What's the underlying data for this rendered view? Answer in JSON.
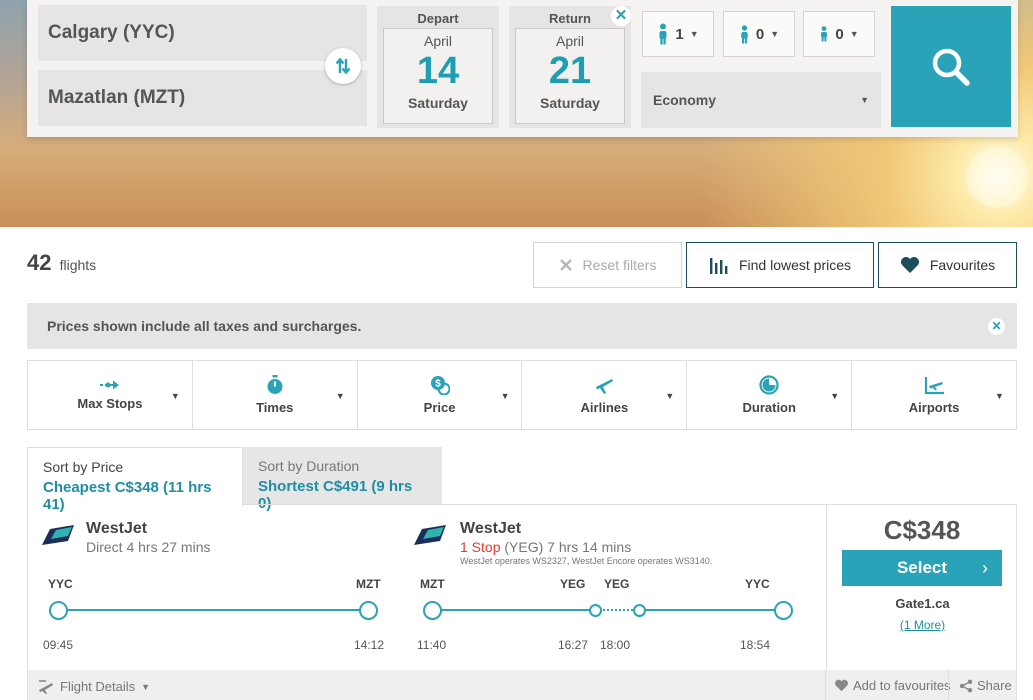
{
  "search": {
    "from": "Calgary (YYC)",
    "to": "Mazatlan (MZT)",
    "depart": {
      "label": "Depart",
      "month": "April",
      "day": "14",
      "weekday": "Saturday"
    },
    "return": {
      "label": "Return",
      "month": "April",
      "day": "21",
      "weekday": "Saturday"
    },
    "passengers": {
      "adults": "1",
      "children": "0",
      "infants": "0"
    },
    "cabin": "Economy",
    "clear_return_icon": "✕"
  },
  "results": {
    "count": "42",
    "count_label": "flights",
    "reset_filters": "Reset filters",
    "find_lowest": "Find lowest prices",
    "favourites": "Favourites",
    "notice": "Prices shown include all taxes and surcharges."
  },
  "filters": [
    "Max Stops",
    "Times",
    "Price",
    "Airlines",
    "Duration",
    "Airports"
  ],
  "sort": {
    "price_label": "Sort by Price",
    "price_value": "Cheapest C$348 (11 hrs 41)",
    "duration_label": "Sort by Duration",
    "duration_value": "Shortest C$491 (9 hrs 0)"
  },
  "flight": {
    "outbound": {
      "airline": "WestJet",
      "summary": "Direct  4 hrs 27 mins",
      "from_code": "YYC",
      "to_code": "MZT",
      "depart_time": "09:45",
      "arrive_time": "14:12"
    },
    "inbound": {
      "airline": "WestJet",
      "stop_count": "1 Stop",
      "stop_detail": " (YEG) 7 hrs 14 mins",
      "operated": "WestJet operates WS2327, WestJet Encore operates WS3140.",
      "from_code": "MZT",
      "via1_code": "YEG",
      "via2_code": "YEG",
      "to_code": "YYC",
      "depart_time": "11:40",
      "via1_time": "16:27",
      "via2_time": "18:00",
      "arrive_time": "18:54"
    },
    "price": "C$348",
    "select_label": "Select",
    "vendor": "Gate1.ca",
    "more_label": "(1 More)",
    "flight_details": "Flight Details",
    "add_favourites": "Add to favourites",
    "share": "Share"
  },
  "colors": {
    "accent": "#2aa3b8",
    "accent_text": "#1f8ea3",
    "stop_red": "#e03b2b",
    "navy": "#1d4f5a"
  }
}
